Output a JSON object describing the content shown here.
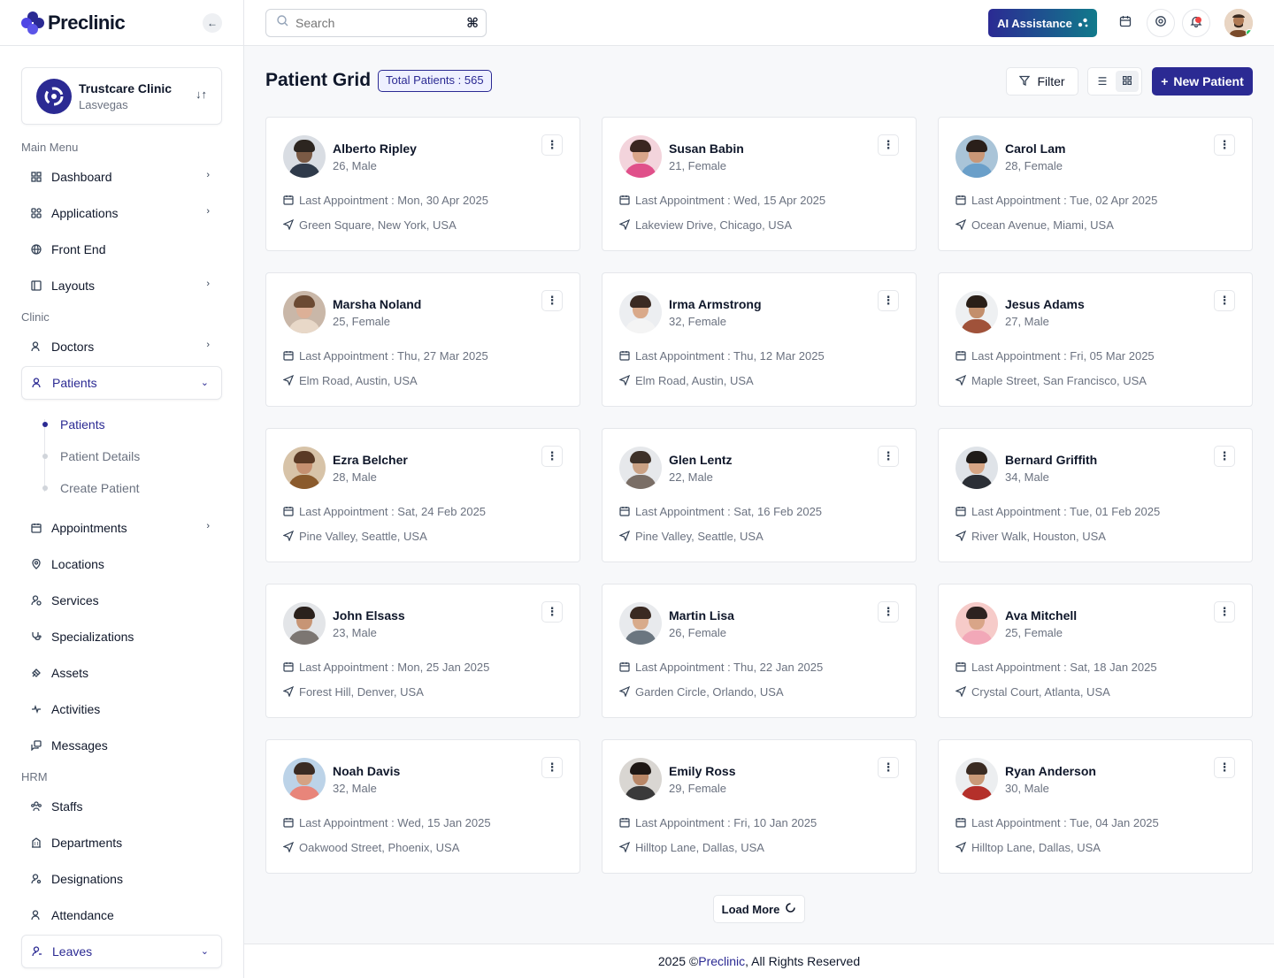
{
  "brand": {
    "name": "Preclinic"
  },
  "clinic": {
    "name": "Trustcare Clinic",
    "location": "Lasvegas"
  },
  "sidebar": {
    "main_menu_label": "Main Menu",
    "main": [
      {
        "label": "Dashboard",
        "icon": "grid-icon"
      },
      {
        "label": "Applications",
        "icon": "apps-icon"
      },
      {
        "label": "Front End",
        "icon": "globe-icon"
      },
      {
        "label": "Layouts",
        "icon": "layout-icon"
      }
    ],
    "clinic_label": "Clinic",
    "doctors_label": "Doctors",
    "patients_label": "Patients",
    "patients_sub": [
      {
        "label": "Patients"
      },
      {
        "label": "Patient Details"
      },
      {
        "label": "Create Patient"
      }
    ],
    "clinic_items": [
      {
        "label": "Appointments",
        "icon": "calendar-icon"
      },
      {
        "label": "Locations",
        "icon": "location-icon"
      },
      {
        "label": "Services",
        "icon": "services-icon"
      },
      {
        "label": "Specializations",
        "icon": "stethoscope-icon"
      },
      {
        "label": "Assets",
        "icon": "assets-icon"
      },
      {
        "label": "Activities",
        "icon": "activity-icon"
      },
      {
        "label": "Messages",
        "icon": "messages-icon"
      }
    ],
    "hrm_label": "HRM",
    "hrm_items": [
      {
        "label": "Staffs",
        "icon": "staff-icon"
      },
      {
        "label": "Departments",
        "icon": "building-icon"
      },
      {
        "label": "Designations",
        "icon": "user-icon"
      },
      {
        "label": "Attendance",
        "icon": "user-check-icon"
      }
    ],
    "leaves_label": "Leaves"
  },
  "header": {
    "search_placeholder": "Search",
    "kbd_hint": "⌘",
    "ai_label": "AI Assistance"
  },
  "page": {
    "title": "Patient Grid",
    "total_badge": "Total Patients : 565",
    "filter_label": "Filter",
    "new_label": "New Patient",
    "load_more_label": "Load More"
  },
  "patients": [
    {
      "name": "Alberto Ripley",
      "meta": "26, Male",
      "appointment": "Last Appointment : Mon, 30 Apr 2025",
      "address": "Green Square, New York, USA"
    },
    {
      "name": "Susan Babin",
      "meta": "21, Female",
      "appointment": "Last Appointment : Wed, 15 Apr 2025",
      "address": "Lakeview Drive, Chicago, USA"
    },
    {
      "name": "Carol Lam",
      "meta": "28, Female",
      "appointment": "Last Appointment : Tue, 02 Apr 2025",
      "address": "Ocean Avenue, Miami, USA"
    },
    {
      "name": "Marsha Noland",
      "meta": "25, Female",
      "appointment": "Last Appointment : Thu, 27 Mar 2025",
      "address": "Elm Road, Austin, USA"
    },
    {
      "name": "Irma Armstrong",
      "meta": "32, Female",
      "appointment": "Last Appointment : Thu, 12 Mar 2025",
      "address": "Elm Road, Austin, USA"
    },
    {
      "name": "Jesus Adams",
      "meta": "27, Male",
      "appointment": "Last Appointment : Fri, 05 Mar 2025",
      "address": "Maple Street, San Francisco, USA"
    },
    {
      "name": "Ezra Belcher",
      "meta": "28, Male",
      "appointment": "Last Appointment : Sat, 24 Feb 2025",
      "address": "Pine Valley, Seattle, USA"
    },
    {
      "name": "Glen Lentz",
      "meta": "22, Male",
      "appointment": "Last Appointment : Sat, 16 Feb 2025",
      "address": "Pine Valley, Seattle, USA"
    },
    {
      "name": "Bernard Griffith",
      "meta": "34, Male",
      "appointment": "Last Appointment : Tue, 01 Feb 2025",
      "address": "River Walk, Houston, USA"
    },
    {
      "name": "John Elsass",
      "meta": "23, Male",
      "appointment": "Last Appointment : Mon, 25 Jan 2025",
      "address": "Forest Hill, Denver, USA"
    },
    {
      "name": "Martin Lisa",
      "meta": "26, Female",
      "appointment": "Last Appointment : Thu, 22 Jan 2025",
      "address": "Garden Circle, Orlando, USA"
    },
    {
      "name": "Ava Mitchell",
      "meta": "25, Female",
      "appointment": "Last Appointment : Sat, 18 Jan 2025",
      "address": "Crystal Court, Atlanta, USA"
    },
    {
      "name": "Noah Davis",
      "meta": "32, Male",
      "appointment": "Last Appointment : Wed, 15 Jan 2025",
      "address": "Oakwood Street, Phoenix, USA"
    },
    {
      "name": "Emily Ross",
      "meta": "29, Female",
      "appointment": "Last Appointment : Fri, 10 Jan 2025",
      "address": "Hilltop Lane, Dallas, USA"
    },
    {
      "name": "Ryan Anderson",
      "meta": "30, Male",
      "appointment": "Last Appointment : Tue, 04 Jan 2025",
      "address": "Hilltop Lane, Dallas, USA"
    }
  ],
  "footer": {
    "prefix": "2025 © ",
    "brand": "Preclinic",
    "suffix": ", All Rights Reserved"
  },
  "colors": {
    "primary": "#2b2a93",
    "ai_gradient_end": "#117a8b",
    "notification": "#ef4444"
  }
}
